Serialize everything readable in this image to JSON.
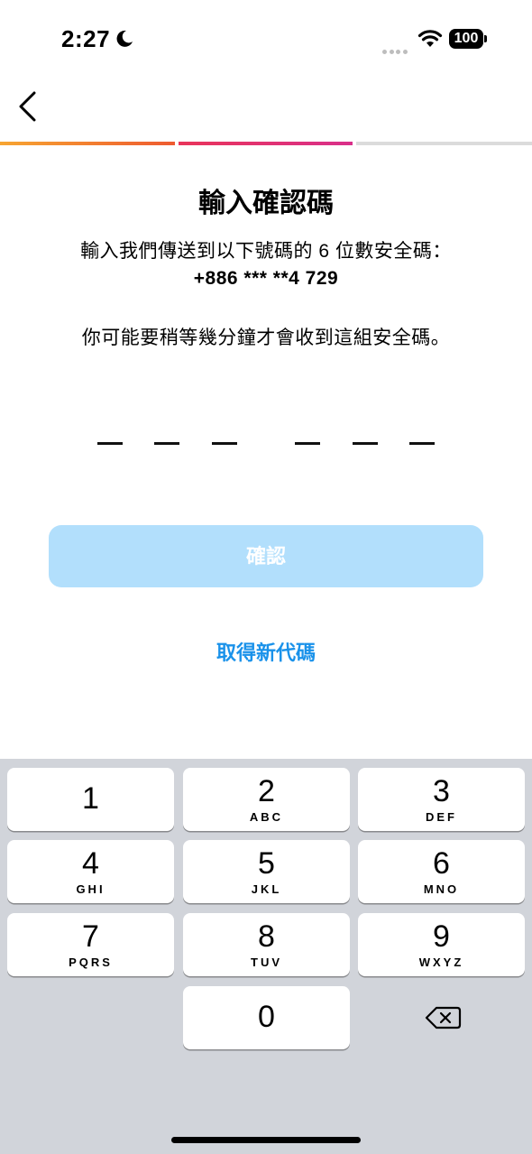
{
  "status_bar": {
    "time": "2:27",
    "battery": "100",
    "icons": [
      "moon-icon",
      "signal-icon",
      "wifi-icon",
      "battery-icon"
    ]
  },
  "nav": {
    "back_icon": "chevron-left-icon"
  },
  "progress": {
    "steps_total": 3,
    "steps_complete": 2
  },
  "main": {
    "title": "輸入確認碼",
    "description": "輸入我們傳送到以下號碼的 6 位數安全碼：",
    "phone": "+886 *** **4 729",
    "wait_note": "你可能要稍等幾分鐘才會收到這組安全碼。",
    "code_length": 6,
    "code_value": "",
    "confirm_label": "確認",
    "resend_label": "取得新代碼"
  },
  "colors": {
    "progress_step1": "#f7a531",
    "progress_step2": "#e9345a",
    "progress_empty": "#dbdbdb",
    "confirm_disabled_bg": "#b2dffc",
    "link": "#1a92ea",
    "keyboard_bg": "#d1d4da"
  },
  "keyboard": {
    "keys": [
      {
        "digit": "1",
        "letters": ""
      },
      {
        "digit": "2",
        "letters": "ABC"
      },
      {
        "digit": "3",
        "letters": "DEF"
      },
      {
        "digit": "4",
        "letters": "GHI"
      },
      {
        "digit": "5",
        "letters": "JKL"
      },
      {
        "digit": "6",
        "letters": "MNO"
      },
      {
        "digit": "7",
        "letters": "PQRS"
      },
      {
        "digit": "8",
        "letters": "TUV"
      },
      {
        "digit": "9",
        "letters": "WXYZ"
      },
      {
        "digit": "0",
        "letters": ""
      }
    ],
    "delete_icon": "backspace-icon"
  }
}
